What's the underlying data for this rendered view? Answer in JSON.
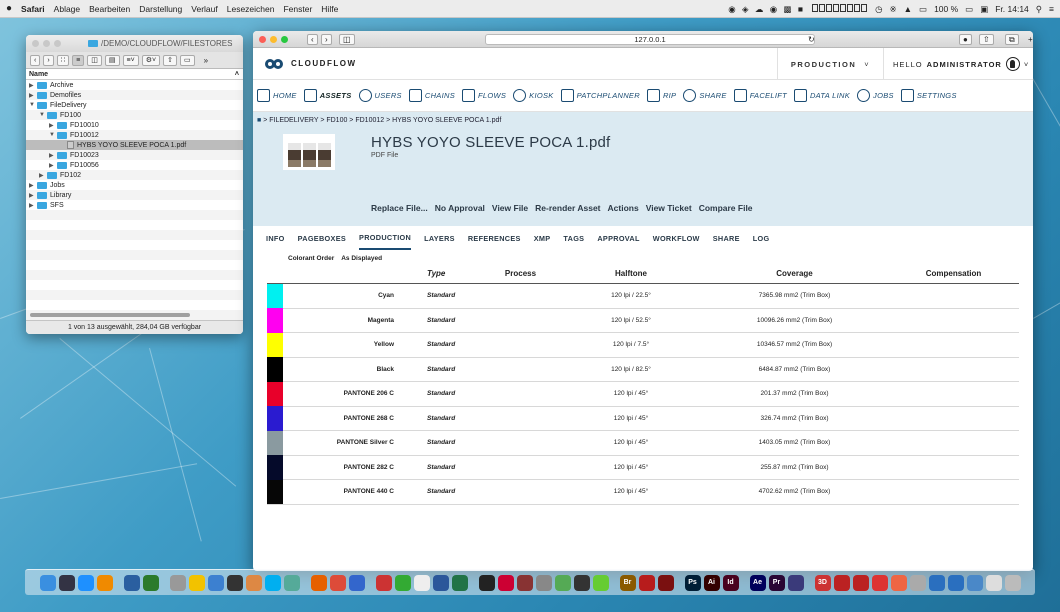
{
  "menubar": {
    "apple": "",
    "items": [
      "Safari",
      "Ablage",
      "Bearbeiten",
      "Darstellung",
      "Verlauf",
      "Lesezeichen",
      "Fenster",
      "Hilfe"
    ],
    "battery": "100 %",
    "clock": "Fr. 14:14"
  },
  "finder": {
    "path": "/DEMO/CLOUDFLOW/FILESTORES",
    "column_header": "Name",
    "rows": [
      {
        "label": "Archive",
        "depth": 0,
        "type": "folder",
        "open": false
      },
      {
        "label": "Demofiles",
        "depth": 0,
        "type": "folder",
        "open": false
      },
      {
        "label": "FileDelivery",
        "depth": 0,
        "type": "folder",
        "open": true
      },
      {
        "label": "FD100",
        "depth": 1,
        "type": "folder",
        "open": true
      },
      {
        "label": "FD10010",
        "depth": 2,
        "type": "folder",
        "open": false
      },
      {
        "label": "FD10012",
        "depth": 2,
        "type": "folder",
        "open": true
      },
      {
        "label": "HYBS YOYO SLEEVE POCA 1.pdf",
        "depth": 3,
        "type": "file",
        "open": false
      },
      {
        "label": "FD10023",
        "depth": 2,
        "type": "folder",
        "open": false
      },
      {
        "label": "FD10056",
        "depth": 2,
        "type": "folder",
        "open": false
      },
      {
        "label": "FD102",
        "depth": 1,
        "type": "folder",
        "open": false
      },
      {
        "label": "Jobs",
        "depth": 0,
        "type": "folder",
        "open": false
      },
      {
        "label": "Library",
        "depth": 0,
        "type": "folder",
        "open": false
      },
      {
        "label": "SFS",
        "depth": 0,
        "type": "folder",
        "open": false
      }
    ],
    "status": "1 von 13 ausgewählt, 284,04 GB verfügbar"
  },
  "browser": {
    "url": "127.0.0.1"
  },
  "header": {
    "brand": "CLOUDFLOW",
    "workspace": "PRODUCTION",
    "greeting": "HELLO",
    "user": "ADMINISTRATOR"
  },
  "nav": [
    {
      "label": "HOME",
      "icon": "home-icon",
      "active": false
    },
    {
      "label": "ASSETS",
      "icon": "database-icon",
      "active": true
    },
    {
      "label": "USERS",
      "icon": "user-icon",
      "active": false
    },
    {
      "label": "CHAINS",
      "icon": "chain-icon",
      "active": false
    },
    {
      "label": "FLOWS",
      "icon": "flows-icon",
      "active": false
    },
    {
      "label": "KIOSK",
      "icon": "kiosk-icon",
      "active": false
    },
    {
      "label": "PATCHPLANNER",
      "icon": "patchplanner-icon",
      "active": false
    },
    {
      "label": "RIP",
      "icon": "rip-icon",
      "active": false
    },
    {
      "label": "SHARE",
      "icon": "share-icon",
      "active": false
    },
    {
      "label": "FACELIFT",
      "icon": "facelift-icon",
      "active": false
    },
    {
      "label": "DATA LINK",
      "icon": "datalink-icon",
      "active": false
    },
    {
      "label": "JOBS",
      "icon": "jobs-icon",
      "active": false
    },
    {
      "label": "SETTINGS",
      "icon": "gear-icon",
      "active": false
    }
  ],
  "asset": {
    "breadcrumb": "> FILEDELIVERY > FD100 > FD10012 > HYBS YOYO SLEEVE POCA 1.pdf",
    "title": "HYBS YOYO SLEEVE POCA 1.pdf",
    "subtitle": "PDF File",
    "actions": [
      "Replace File...",
      "No Approval",
      "View File",
      "Re-render Asset",
      "Actions",
      "View Ticket",
      "Compare File"
    ]
  },
  "tabs": [
    "INFO",
    "PAGEBOXES",
    "PRODUCTION",
    "LAYERS",
    "REFERENCES",
    "XMP",
    "TAGS",
    "APPROVAL",
    "WORKFLOW",
    "SHARE",
    "LOG"
  ],
  "active_tab": "PRODUCTION",
  "subtabs": [
    "Colorant Order",
    "As Displayed"
  ],
  "table": {
    "headers": {
      "type": "Type",
      "process": "Process",
      "halftone": "Halftone",
      "coverage": "Coverage",
      "compensation": "Compensation"
    },
    "rows": [
      {
        "name": "Cyan",
        "color": "#00f0f0",
        "type": "Standard",
        "process": "",
        "halftone": "120 lpi / 22.5°",
        "coverage": "7365.98 mm2 (Trim Box)",
        "compensation": ""
      },
      {
        "name": "Magenta",
        "color": "#ff00f0",
        "type": "Standard",
        "process": "",
        "halftone": "120 lpi / 52.5°",
        "coverage": "10096.26 mm2 (Trim Box)",
        "compensation": ""
      },
      {
        "name": "Yellow",
        "color": "#ffff00",
        "type": "Standard",
        "process": "",
        "halftone": "120 lpi / 7.5°",
        "coverage": "10346.57 mm2 (Trim Box)",
        "compensation": ""
      },
      {
        "name": "Black",
        "color": "#000000",
        "type": "Standard",
        "process": "",
        "halftone": "120 lpi / 82.5°",
        "coverage": "6484.87 mm2 (Trim Box)",
        "compensation": ""
      },
      {
        "name": "PANTONE 206 C",
        "color": "#e8002a",
        "type": "Standard",
        "process": "",
        "halftone": "120 lpi / 45°",
        "coverage": "201.37 mm2 (Trim Box)",
        "compensation": ""
      },
      {
        "name": "PANTONE 268 C",
        "color": "#2a1bd0",
        "type": "Standard",
        "process": "",
        "halftone": "120 lpi / 45°",
        "coverage": "326.74 mm2 (Trim Box)",
        "compensation": ""
      },
      {
        "name": "PANTONE Silver C",
        "color": "#8a9aa0",
        "type": "Standard",
        "process": "",
        "halftone": "120 lpi / 45°",
        "coverage": "1403.05 mm2 (Trim Box)",
        "compensation": ""
      },
      {
        "name": "PANTONE 282 C",
        "color": "#050a2a",
        "type": "Standard",
        "process": "",
        "halftone": "120 lpi / 45°",
        "coverage": "255.87 mm2 (Trim Box)",
        "compensation": ""
      },
      {
        "name": "PANTONE 440 C",
        "color": "#060606",
        "type": "Standard",
        "process": "",
        "halftone": "120 lpi / 45°",
        "coverage": "4702.62 mm2 (Trim Box)",
        "compensation": ""
      }
    ]
  },
  "dock": {
    "apps": [
      {
        "name": "finder-app",
        "color": "#3a8fe0"
      },
      {
        "name": "mission-control-app",
        "color": "#334"
      },
      {
        "name": "safari-app",
        "color": "#1e90ff"
      },
      {
        "name": "vlc-app",
        "color": "#f08a00"
      },
      {
        "name": "network-app",
        "color": "#2a5fa0"
      },
      {
        "name": "fish-app",
        "color": "#2b7a2b"
      },
      {
        "name": "cloud-app",
        "color": "#999"
      },
      {
        "name": "star-app",
        "color": "#f2c200"
      },
      {
        "name": "remote-app",
        "color": "#3c80d0"
      },
      {
        "name": "cycle-app",
        "color": "#333"
      },
      {
        "name": "game-app",
        "color": "#d84"
      },
      {
        "name": "skype-app",
        "color": "#00aff0"
      },
      {
        "name": "chat-app",
        "color": "#5a9"
      },
      {
        "name": "firefox-app",
        "color": "#e66000"
      },
      {
        "name": "chrome-app",
        "color": "#dd4b39"
      },
      {
        "name": "orb-app",
        "color": "#3366cc"
      },
      {
        "name": "filemaker-app",
        "color": "#c33"
      },
      {
        "name": "chart-app",
        "color": "#3a3"
      },
      {
        "name": "notes-app",
        "color": "#eee"
      },
      {
        "name": "word-app",
        "color": "#2b579a"
      },
      {
        "name": "excel-app",
        "color": "#217346"
      },
      {
        "name": "pen-app",
        "color": "#222"
      },
      {
        "name": "x-app",
        "color": "#c03"
      },
      {
        "name": "book-app",
        "color": "#833"
      },
      {
        "name": "tools-app",
        "color": "#888"
      },
      {
        "name": "plant-app",
        "color": "#5a5"
      },
      {
        "name": "globe-app",
        "color": "#333"
      },
      {
        "name": "bug-app",
        "color": "#6c3"
      },
      {
        "name": "bridge-app",
        "color": "#8a5a00",
        "label": "Br"
      },
      {
        "name": "acrobat1-app",
        "color": "#b71c1c"
      },
      {
        "name": "acrobat2-app",
        "color": "#7a1010"
      },
      {
        "name": "photoshop-app",
        "color": "#001e36",
        "label": "Ps"
      },
      {
        "name": "illustrator-app",
        "color": "#330000",
        "label": "Ai"
      },
      {
        "name": "indesign-app",
        "color": "#49021f",
        "label": "Id"
      },
      {
        "name": "aftereffects-app",
        "color": "#00005b",
        "label": "Ae"
      },
      {
        "name": "premiere-app",
        "color": "#2a0634",
        "label": "Pr"
      },
      {
        "name": "media-app",
        "color": "#3a3a7a"
      },
      {
        "name": "3d-app",
        "color": "#c33",
        "label": "3D"
      },
      {
        "name": "z1-app",
        "color": "#b22"
      },
      {
        "name": "z2-app",
        "color": "#b22"
      },
      {
        "name": "pdf-app",
        "color": "#d33"
      },
      {
        "name": "fox-app",
        "color": "#e64"
      },
      {
        "name": "mail-app",
        "color": "#aaa"
      },
      {
        "name": "cf1-app",
        "color": "#2a6fbf"
      },
      {
        "name": "cf2-app",
        "color": "#2a6fbf"
      },
      {
        "name": "preview-app",
        "color": "#4a88c8"
      },
      {
        "name": "docs-app",
        "color": "#ddd"
      },
      {
        "name": "trash-app",
        "color": "#bbb"
      }
    ]
  }
}
